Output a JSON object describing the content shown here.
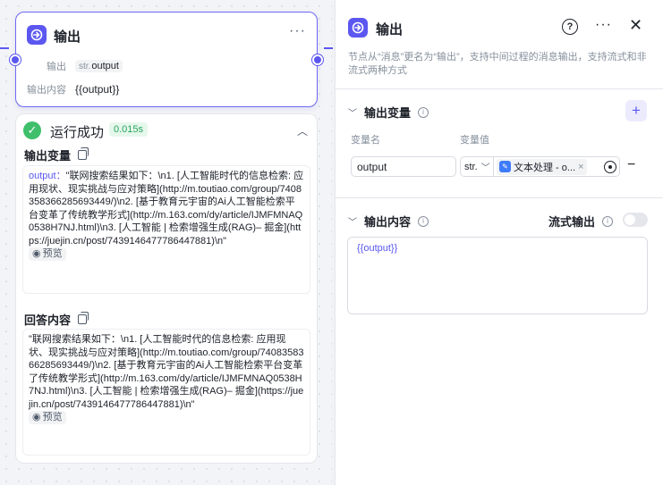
{
  "node": {
    "title": "输出",
    "more": "···",
    "output_label": "输出",
    "output_type": "str.",
    "output_name": "output",
    "content_label": "输出内容",
    "content_value": "{{output}}"
  },
  "result": {
    "status": "运行成功",
    "time": "0.015s",
    "output_var_title": "输出变量",
    "output_key": "output：",
    "output_text": "\"联网搜索结果如下：\\n1. [人工智能时代的信息检索: 应用现状、现实挑战与应对策略](http://m.toutiao.com/group/7408358366285693449/)\\n2. [基于教育元宇宙的Ai人工智能检索平台变革了传统教学形式](http://m.163.com/dy/article/IJMFMNAQ0538H7NJ.html)\\n3. [人工智能 | 检索增强生成(RAG)– 掘金](https://juejin.cn/post/7439146477786447881)\\n\"",
    "preview_label": "预览",
    "answer_title": "回答内容",
    "answer_text": "\"联网搜索结果如下：\\n1. [人工智能时代的信息检索: 应用现状、现实挑战与应对策略](http://m.toutiao.com/group/7408358366285693449/)\\n2. [基于教育元宇宙的Ai人工智能检索平台变革了传统教学形式](http://m.163.com/dy/article/IJMFMNAQ0538H7NJ.html)\\n3. [人工智能 | 检索增强生成(RAG)– 掘金](https://juejin.cn/post/7439146477786447881)\\n\""
  },
  "panel": {
    "title": "输出",
    "help": "?",
    "more": "···",
    "close": "✕",
    "description": "节点从“消息”更名为“输出”，支持中间过程的消息输出，支持流式和非流式两种方式",
    "vars_section": "输出变量",
    "add": "+",
    "col_name": "变量名",
    "col_value": "变量值",
    "var_name_value": "output",
    "var_type": "str.",
    "var_ref": "文本处理 - o...",
    "content_section": "输出内容",
    "stream_label": "流式输出",
    "stream_on": false,
    "content_value": "{{output}}"
  },
  "colors": {
    "accent": "#5b57f0",
    "success": "#3fbf6b"
  },
  "icons": [
    "output-node-icon",
    "more-icon",
    "copy-icon",
    "eye-icon",
    "help-icon",
    "close-icon",
    "chevron-down-icon",
    "info-icon",
    "plus-icon",
    "target-icon",
    "minus-icon",
    "check-icon",
    "chevron-up-icon"
  ]
}
